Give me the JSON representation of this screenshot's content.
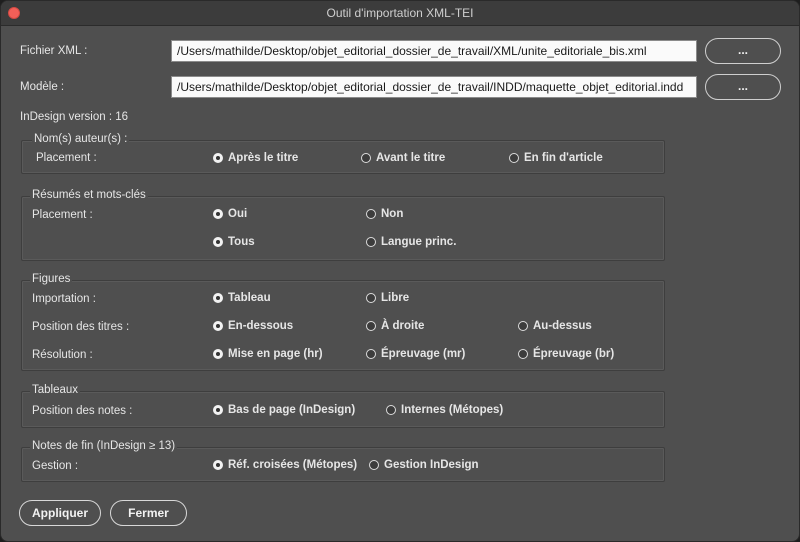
{
  "window": {
    "title": "Outil d'importation XML-TEI"
  },
  "xml_file": {
    "label": "Fichier XML :",
    "value": "/Users/mathilde/Desktop/objet_editorial_dossier_de_travail/XML/unite_editoriale_bis.xml",
    "browse": "..."
  },
  "model_file": {
    "label": "Modèle :",
    "value": "/Users/mathilde/Desktop/objet_editorial_dossier_de_travail/INDD/maquette_objet_editorial.indd",
    "browse": "..."
  },
  "version": "InDesign version : 16",
  "authors": {
    "title": "Nom(s) auteur(s) :",
    "placement_label": "Placement :",
    "options": [
      "Après le titre",
      "Avant le titre",
      "En fin d'article"
    ]
  },
  "abstracts": {
    "title": "Résumés et mots-clés",
    "placement_label": "Placement :",
    "row1": [
      "Oui",
      "Non"
    ],
    "row2": [
      "Tous",
      "Langue princ."
    ]
  },
  "figures": {
    "title": "Figures",
    "import_label": "Importation :",
    "import_options": [
      "Tableau",
      "Libre"
    ],
    "titles_label": "Position des titres :",
    "titles_options": [
      "En-dessous",
      "À droite",
      "Au-dessus"
    ],
    "res_label": "Résolution :",
    "res_options": [
      "Mise en page (hr)",
      "Épreuvage (mr)",
      "Épreuvage (br)"
    ]
  },
  "tables": {
    "title": "Tableaux",
    "notes_label": "Position des notes :",
    "notes_options": [
      "Bas de page (InDesign)",
      "Internes (Métopes)"
    ]
  },
  "endnotes": {
    "title": "Notes de fin (InDesign ≥ 13)",
    "mgmt_label": "Gestion :",
    "mgmt_options": [
      "Réf. croisées (Métopes)",
      "Gestion InDesign"
    ]
  },
  "buttons": {
    "apply": "Appliquer",
    "close": "Fermer"
  }
}
